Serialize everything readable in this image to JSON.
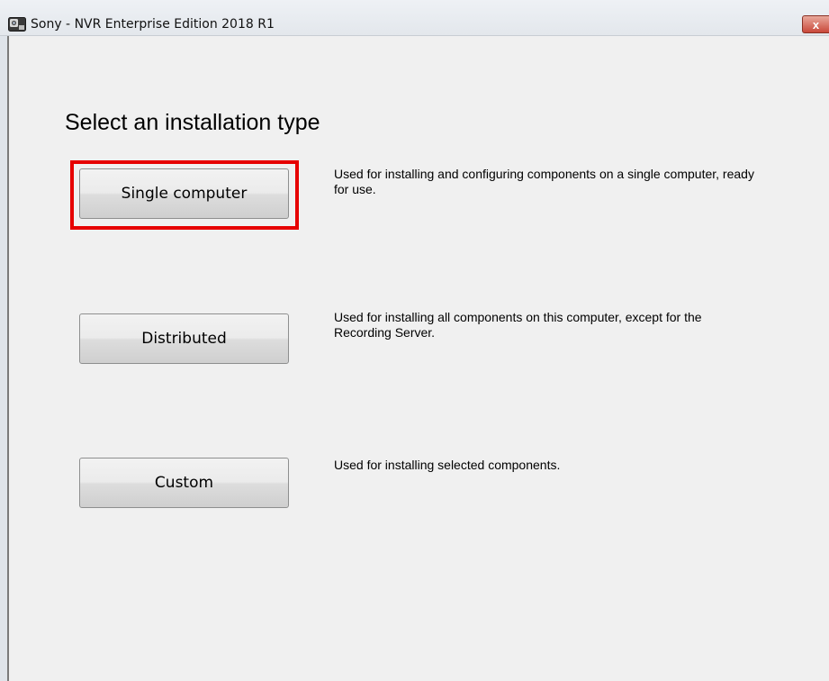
{
  "window": {
    "title": "Sony - NVR Enterprise Edition 2018 R1",
    "close_label": "x"
  },
  "main": {
    "heading": "Select an installation type",
    "options": [
      {
        "label": "Single computer",
        "description": "Used for installing and configuring components on a single computer, ready for use.",
        "highlighted": true
      },
      {
        "label": "Distributed",
        "description": "Used for installing all components on this computer, except for the Recording Server.",
        "highlighted": false
      },
      {
        "label": "Custom",
        "description": "Used for installing selected components.",
        "highlighted": false
      }
    ]
  },
  "colors": {
    "highlight": "#e60000",
    "background": "#f0f0f0"
  }
}
